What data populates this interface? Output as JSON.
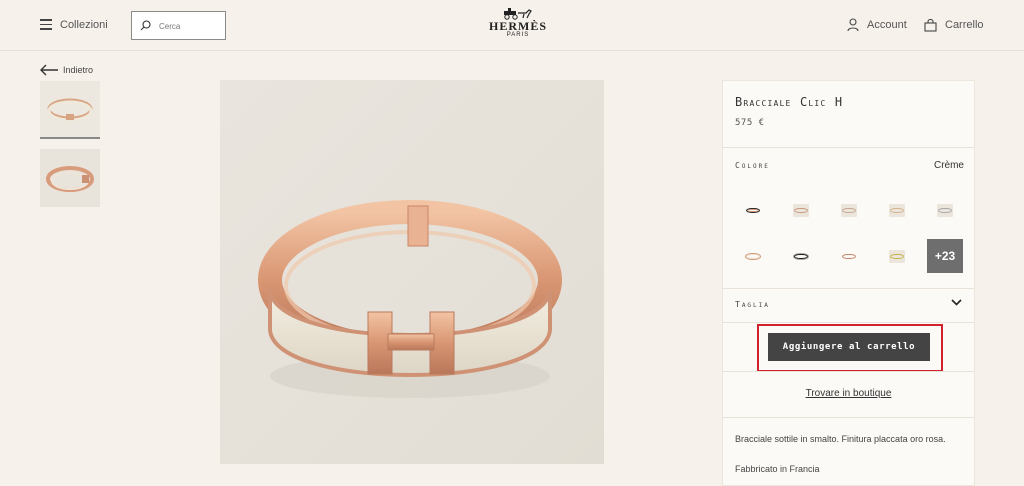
{
  "header": {
    "collections_label": "Collezioni",
    "search_placeholder": "Cerca",
    "logo_brand": "HERMÈS",
    "logo_city": "PARIS",
    "account_label": "Account",
    "cart_label": "Carrello"
  },
  "nav": {
    "back_label": "Indietro"
  },
  "product": {
    "title": "Bracciale Clic H",
    "price": "575 €",
    "color_section_label": "Colore",
    "color_value": "Crème",
    "more_colors": "+23",
    "size_section_label": "Taglia",
    "add_to_cart_label": "Aggiungere al carrello",
    "boutique_link": "Trovare in boutique",
    "description": "Bracciale sottile in smalto. Finitura placcata oro rosa.",
    "made_in": "Fabbricato in Francia"
  },
  "colors": {
    "highlight": "#d3202d",
    "button": "#444444",
    "background": "#f6f1eb"
  }
}
